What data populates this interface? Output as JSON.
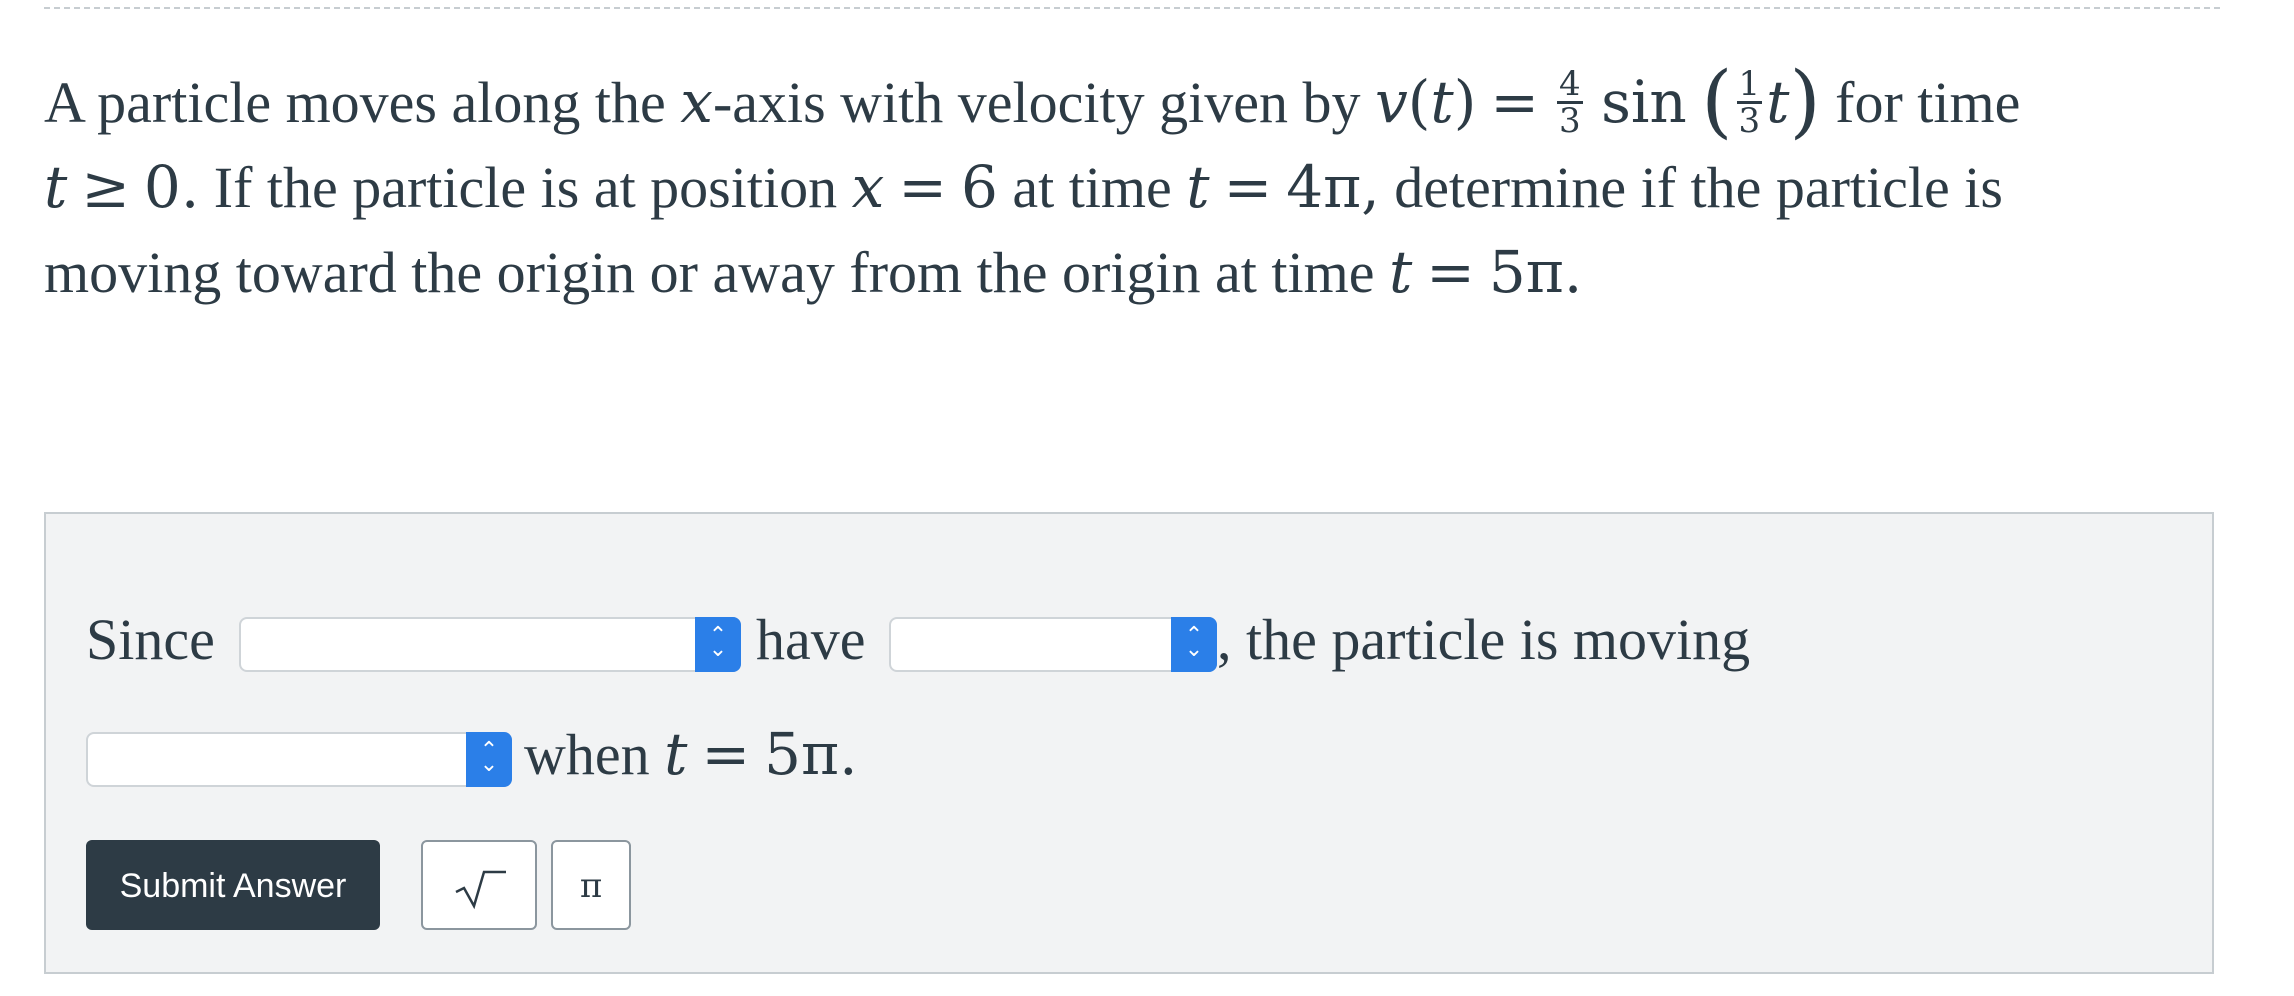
{
  "question": {
    "part1": "A particle moves along the ",
    "x_italic": "x",
    "part2": "-axis with velocity given by ",
    "v_symbol": "v",
    "t_arg": "t",
    "equals1": "=",
    "frac1_num": "4",
    "frac1_den": "3",
    "sin_word": "sin",
    "frac2_num": "1",
    "frac2_den": "3",
    "t_in_sin": "t",
    "part3": " for time",
    "t_cond": "t",
    "geq": "≥",
    "zero_dot": "0.",
    "part4": " If the particle is at position ",
    "x_pos": "x",
    "equals2": "=",
    "six": "6",
    "part5": " at time ",
    "t_time": "t",
    "equals3": "=",
    "four_pi": "4π,",
    "part6": " determine if the particle is",
    "part7": "moving toward the origin or away from the origin at time ",
    "t_final": "t",
    "equals4": "=",
    "five_pi": "5π."
  },
  "answer": {
    "since_label": "Since",
    "have_label": "have",
    "moving_label": ", the particle is moving",
    "when_label": "when ",
    "when_t": "t",
    "when_equals": "=",
    "when_value": "5π.",
    "dropdown1_value": "",
    "dropdown2_value": "",
    "dropdown3_value": ""
  },
  "toolbar": {
    "submit_label": "Submit Answer",
    "sqrt_icon": "square-root-icon",
    "pi_label": "π"
  },
  "colors": {
    "text": "#2d3b45",
    "panel_bg": "#f2f3f4",
    "panel_border": "#c7cdd1",
    "select_accent": "#2b7fe8",
    "submit_bg": "#2d3b45"
  }
}
